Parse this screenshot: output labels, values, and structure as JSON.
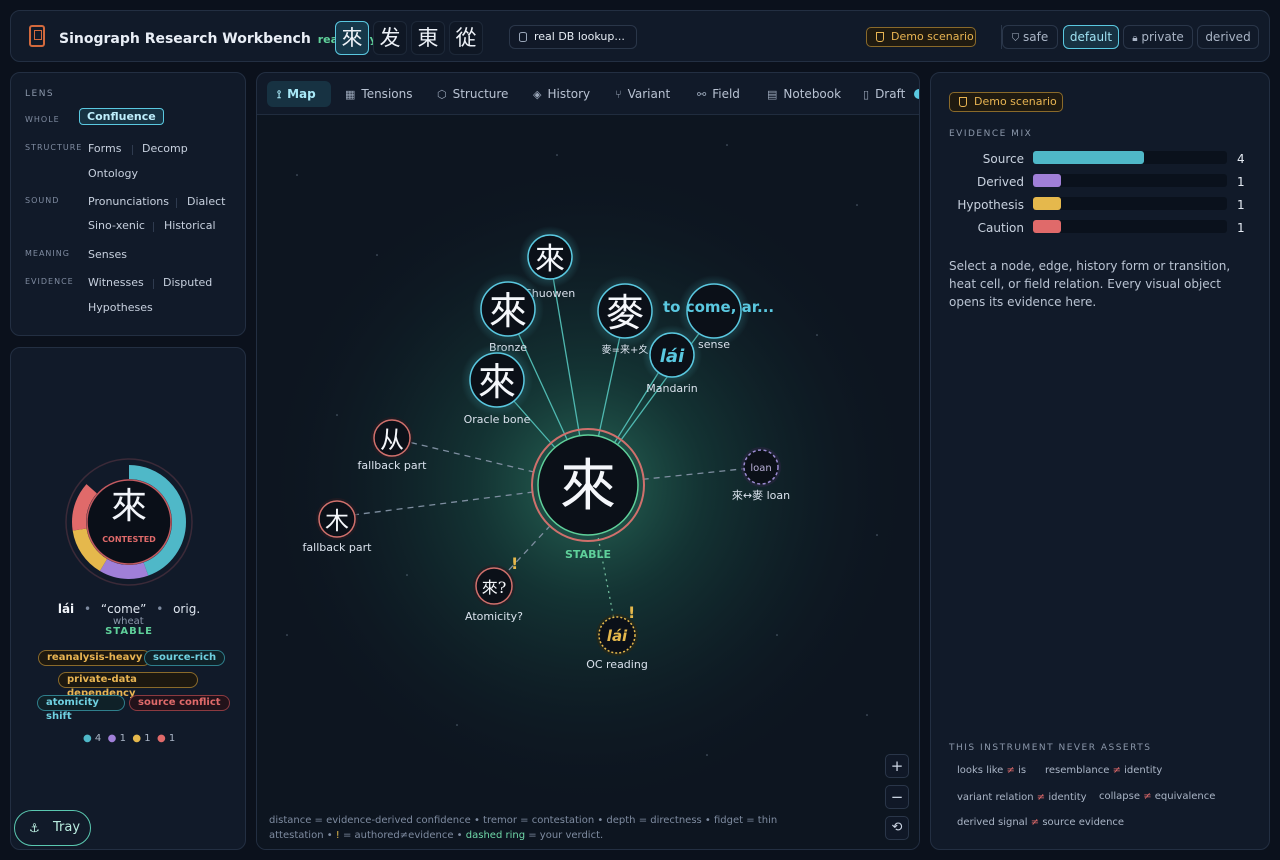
{
  "header": {
    "title": "Sinograph Research Workbench",
    "mode": "read-only",
    "glyphs": [
      "來",
      "发",
      "東",
      "從"
    ],
    "db_button": "real DB lookup...",
    "demo": "Demo scenario",
    "privacy": [
      "safe",
      "default",
      "private",
      "derived"
    ],
    "privacy_selected": "default"
  },
  "lens": {
    "title": "LENS",
    "whole_label": "WHOLE",
    "whole": [
      "Confluence"
    ],
    "structure_label": "STRUCTURE",
    "structure": [
      "Forms",
      "Decomp",
      "Ontology"
    ],
    "sound_label": "SOUND",
    "sound": [
      "Pronunciations",
      "Dialect",
      "Sino-xenic",
      "Historical"
    ],
    "meaning_label": "MEANING",
    "meaning": [
      "Senses"
    ],
    "evidence_label": "EVIDENCE",
    "evidence": [
      "Witnesses",
      "Disputed",
      "Hypotheses"
    ]
  },
  "card": {
    "glyph": "來",
    "status": "CONTESTED",
    "reading": "lái",
    "gloss": "“come”",
    "orig_label": "orig.",
    "orig_value": "wheat",
    "stability": "STABLE",
    "tags": [
      "reanalysis-heavy",
      "source-rich",
      "private-data dependency",
      "atomicity shift",
      "source conflict"
    ],
    "counts": [
      "4",
      "1",
      "1",
      "1"
    ],
    "tray": "Tray"
  },
  "tabs": [
    "Map",
    "Tensions",
    "Structure",
    "History",
    "Variant",
    "Field",
    "Notebook",
    "Draft"
  ],
  "active_tab": "Map",
  "map": {
    "center_glyph": "來",
    "center_status": "STABLE",
    "nodes": [
      {
        "glyph": "來",
        "label": "Shuowen"
      },
      {
        "glyph": "來",
        "label": "Bronze"
      },
      {
        "glyph": "來",
        "label": "Oracle bone"
      },
      {
        "glyph": "麥",
        "label": "麥=来+夊"
      },
      {
        "glyph": "",
        "label": "sense",
        "floating": "to come, ar..."
      },
      {
        "glyph": "lái",
        "label": "Mandarin"
      },
      {
        "glyph": "从",
        "label": "fallback part"
      },
      {
        "glyph": "木",
        "label": "fallback part"
      },
      {
        "glyph": "loan",
        "label": "來↔麥 loan"
      },
      {
        "glyph": "來?",
        "label": "Atomicity?"
      },
      {
        "glyph": "lái",
        "label": "OC reading"
      }
    ],
    "legend_line1": "distance = evidence-derived confidence  •  tremor = contestation  •  depth = directness  •  fidget = thin",
    "legend_line2_a": "attestation  •  ",
    "legend_line2_b": "!",
    "legend_line2_c": " = authored≠evidence  •  ",
    "legend_line2_d": "dashed ring",
    "legend_line2_e": " = your verdict."
  },
  "right": {
    "demo": "Demo scenario",
    "mix_title": "EVIDENCE MIX",
    "bars": [
      {
        "label": "Source",
        "value": 4,
        "color": "#4fb8c8"
      },
      {
        "label": "Derived",
        "value": 1,
        "color": "#a07fd8"
      },
      {
        "label": "Hypothesis",
        "value": 1,
        "color": "#e5b84c"
      },
      {
        "label": "Caution",
        "value": 1,
        "color": "#e06a6a"
      }
    ],
    "max_value": 7,
    "description": "Select a node, edge, history form or transition, heat cell, or field relation. Every visual object opens its evidence here.",
    "never_title": "THIS INSTRUMENT NEVER ASSERTS",
    "asserts": [
      [
        "looks like",
        "is"
      ],
      [
        "resemblance",
        "identity"
      ],
      [
        "variant relation",
        "identity"
      ],
      [
        "collapse",
        "equivalence"
      ],
      [
        "derived signal",
        "source evidence"
      ]
    ]
  }
}
